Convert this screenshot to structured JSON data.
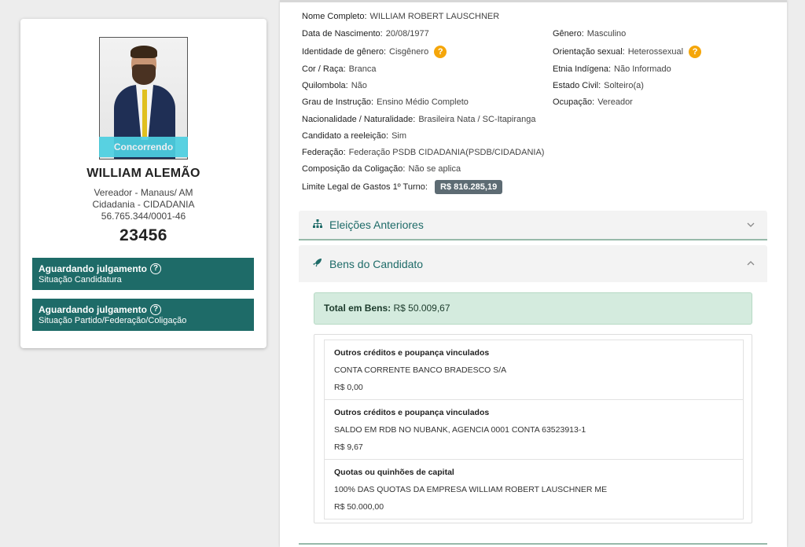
{
  "candidate": {
    "status_overlay": "Concorrendo",
    "name": "WILLIAM ALEMÃO",
    "role_location": "Vereador - Manaus/ AM",
    "party": "Cidadania - CIDADANIA",
    "cnpj": "56.765.344/0001-46",
    "number": "23456",
    "status_boxes": [
      {
        "title": "Aguardando julgamento",
        "subtitle": "Situação Candidatura"
      },
      {
        "title": "Aguardando julgamento",
        "subtitle": "Situação Partido/Federação/Coligação"
      }
    ]
  },
  "details": {
    "full_name": {
      "label": "Nome Completo:",
      "value": "WILLIAM ROBERT LAUSCHNER"
    },
    "birth": {
      "label": "Data de Nascimento:",
      "value": "20/08/1977"
    },
    "gender": {
      "label": "Gênero:",
      "value": "Masculino"
    },
    "gender_identity": {
      "label": "Identidade de gênero:",
      "value": "Cisgênero"
    },
    "sexual_orientation": {
      "label": "Orientação sexual:",
      "value": "Heterossexual"
    },
    "race": {
      "label": "Cor / Raça:",
      "value": "Branca"
    },
    "indigenous": {
      "label": "Etnia Indígena:",
      "value": "Não Informado"
    },
    "quilombola": {
      "label": "Quilombola:",
      "value": "Não"
    },
    "civil_status": {
      "label": "Estado Civil:",
      "value": "Solteiro(a)"
    },
    "education": {
      "label": "Grau de Instrução:",
      "value": "Ensino Médio Completo"
    },
    "occupation": {
      "label": "Ocupação:",
      "value": "Vereador"
    },
    "nationality": {
      "label": "Nacionalidade / Naturalidade:",
      "value": "Brasileira Nata / SC-Itapiranga"
    },
    "reelection": {
      "label": "Candidato a reeleição:",
      "value": "Sim"
    },
    "federation": {
      "label": "Federação:",
      "value": "Federação PSDB CIDADANIA(PSDB/CIDADANIA)"
    },
    "coalition": {
      "label": "Composição da Coligação:",
      "value": "Não se aplica"
    },
    "spending_limit": {
      "label": "Limite Legal de Gastos 1º Turno:",
      "value": "R$ 816.285,19"
    },
    "help_glyph": "?"
  },
  "sections": {
    "previous_elections": {
      "title": "Eleições Anteriores",
      "icon": "sitemap-icon",
      "expanded": false
    },
    "assets": {
      "title": "Bens do Candidato",
      "icon": "rocket-icon",
      "expanded": true
    }
  },
  "assets": {
    "total_label": "Total em Bens:",
    "total_value": "R$ 50.009,67",
    "items": [
      {
        "type": "Outros créditos e poupança vinculados",
        "description": "CONTA CORRENTE BANCO BRADESCO S/A",
        "value": "R$ 0,00"
      },
      {
        "type": "Outros créditos e poupança vinculados",
        "description": "SALDO EM RDB NO NUBANK, AGENCIA 0001 CONTA 63523913-1",
        "value": "R$ 9,67"
      },
      {
        "type": "Quotas ou quinhões de capital",
        "description": "100% DAS QUOTAS DA EMPRESA WILLIAM ROBERT LAUSCHNER ME",
        "value": "R$ 50.000,00"
      }
    ]
  },
  "colors": {
    "accent": "#1e6b68",
    "status_overlay": "#4dd0e1",
    "help_orange": "#f5a60a",
    "total_bg": "#d4ebde"
  }
}
